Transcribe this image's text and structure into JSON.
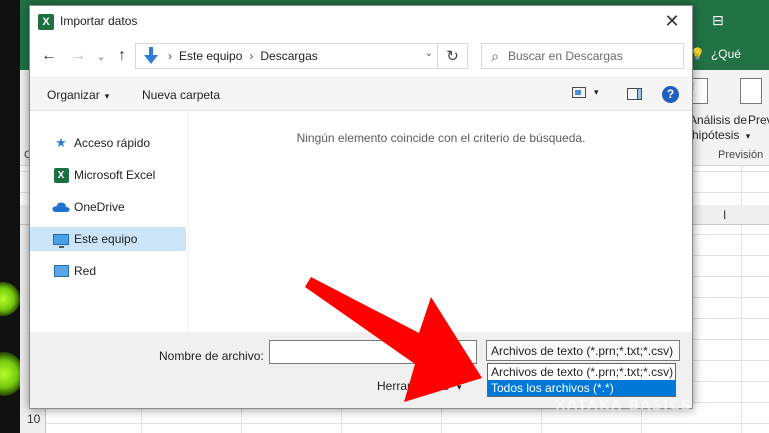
{
  "excel": {
    "ribbon_tell": "¿Qué",
    "whatif_line1": "Análisis de",
    "whatif_line2": "hipótesis",
    "whatif_caret": "▾",
    "forecast_label": "Prev",
    "group_label": "Previsión",
    "col_letter": "I",
    "row_number": "10",
    "left_letter": "C"
  },
  "dialog": {
    "title": "Importar datos",
    "close_glyph": "✕",
    "nav": {
      "back": "←",
      "forward": "→",
      "recent": "⌄",
      "up": "↑",
      "path": [
        "Este equipo",
        "Descargas"
      ],
      "separator": "›",
      "refresh": "↻",
      "search_placeholder": "Buscar en Descargas"
    },
    "commands": {
      "organize": "Organizar",
      "new_folder": "Nueva carpeta",
      "caret": "▾",
      "help": "?"
    },
    "sidebar": {
      "items": [
        {
          "label": "Acceso rápido",
          "icon": "star-icon"
        },
        {
          "label": "Microsoft Excel",
          "icon": "excel-icon"
        },
        {
          "label": "OneDrive",
          "icon": "cloud-icon"
        },
        {
          "label": "Este equipo",
          "icon": "computer-icon",
          "selected": true
        },
        {
          "label": "Red",
          "icon": "network-icon"
        }
      ]
    },
    "empty_message": "Ningún elemento coincide con el criterio de búsqueda.",
    "bottom": {
      "filename_label": "Nombre de archivo:",
      "filename_value": "",
      "filter_selected": "Archivos de texto (*.prn;*.txt;*.csv)",
      "filter_options": [
        "Archivos de texto (*.prn;*.txt;*.csv)",
        "Todos los archivos (*.*)"
      ],
      "filter_highlighted": 1,
      "tools": "Herramientas",
      "tools_caret": "▾"
    }
  },
  "overlay": {
    "arrow_color": "#ff0000",
    "watermark": "XATAKA BASICS"
  },
  "colors": {
    "excel_green": "#217346",
    "selection_blue": "#0078d7",
    "nav_selected": "#cce4f7"
  }
}
